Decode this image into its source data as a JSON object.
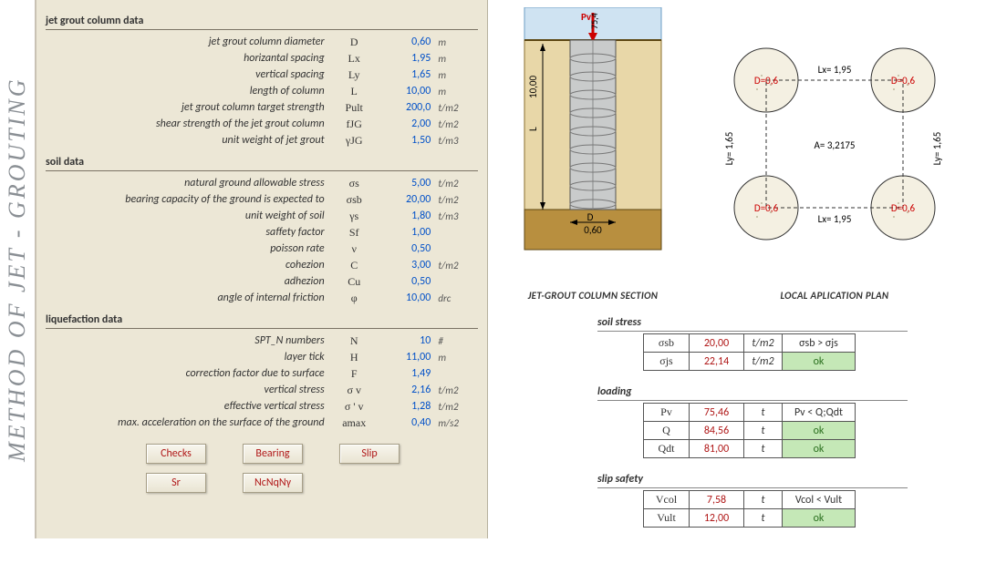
{
  "sideTitle": "METHOD OF JET - GROUTING",
  "sections": {
    "jg": {
      "title": "jet grout column data",
      "rows": [
        {
          "lbl": "jet grout column diameter",
          "sym": "D",
          "val": "0,60",
          "unit": "m"
        },
        {
          "lbl": "horizantal spacing",
          "sym": "Lx",
          "val": "1,95",
          "unit": "m"
        },
        {
          "lbl": "vertical spacing",
          "sym": "Ly",
          "val": "1,65",
          "unit": "m"
        },
        {
          "lbl": "length of column",
          "sym": "L",
          "val": "10,00",
          "unit": "m"
        },
        {
          "lbl": "jet grout column target strength",
          "sym": "Pult",
          "val": "200,0",
          "unit": "t/m2"
        },
        {
          "lbl": "shear strength of the jet grout column",
          "sym": "fJG",
          "val": "2,00",
          "unit": "t/m2"
        },
        {
          "lbl": "unit weight of jet grout",
          "sym": "γJG",
          "val": "1,50",
          "unit": "t/m3"
        }
      ]
    },
    "soil": {
      "title": "soil data",
      "rows": [
        {
          "lbl": "natural ground allowable stress",
          "sym": "σs",
          "val": "5,00",
          "unit": "t/m2"
        },
        {
          "lbl": "bearing capacity of the ground is expected to",
          "sym": "σsb",
          "val": "20,00",
          "unit": "t/m2"
        },
        {
          "lbl": "unit weight of soil",
          "sym": "γs",
          "val": "1,80",
          "unit": "t/m3"
        },
        {
          "lbl": "saffety factor",
          "sym": "Sf",
          "val": "1,00",
          "unit": ""
        },
        {
          "lbl": "poisson rate",
          "sym": "ν",
          "val": "0,50",
          "unit": ""
        },
        {
          "lbl": "cohezion",
          "sym": "C",
          "val": "3,00",
          "unit": "t/m2"
        },
        {
          "lbl": "adhezion",
          "sym": "Cu",
          "val": "0,50",
          "unit": ""
        },
        {
          "lbl": "angle of internal friction",
          "sym": "φ",
          "val": "10,00",
          "unit": "drc"
        }
      ]
    },
    "liq": {
      "title": "liquefaction data",
      "rows": [
        {
          "lbl": "SPT_N numbers",
          "sym": "N",
          "val": "10",
          "unit": "#"
        },
        {
          "lbl": "layer tick",
          "sym": "H",
          "val": "11,00",
          "unit": "m"
        },
        {
          "lbl": "correction factor due to surface",
          "sym": "F",
          "val": "1,49",
          "unit": ""
        },
        {
          "lbl": "vertical stress",
          "sym": "σ v",
          "val": "2,16",
          "unit": "t/m2"
        },
        {
          "lbl": "effective vertical stress",
          "sym": "σ ' v",
          "val": "1,28",
          "unit": "t/m2"
        },
        {
          "lbl": "max. acceleration on the surface of the ground",
          "sym": "amax",
          "val": "0,40",
          "unit": "m/s2"
        }
      ]
    }
  },
  "buttons": {
    "checks": "Checks",
    "bearing": "Bearing",
    "slip": "Slip",
    "sr": "Sr",
    "ncnqny": "NcNqNγ"
  },
  "figSection": {
    "pvLabel": "Pv",
    "pvVal": "75,4",
    "L": "10,00",
    "Dlabel": "D",
    "Dval": "0,60",
    "caption": "JET-GROUT COLUMN SECTION"
  },
  "figPlan": {
    "D": "D=0,6",
    "Lx": "Lx= 1,95",
    "Ly": "Ly= 1,65",
    "A": "A= 3,2175",
    "caption": "LOCAL APLICATION PLAN"
  },
  "checks": {
    "soil": {
      "title": "soil stress",
      "rows": [
        {
          "sym": "σsb",
          "val": "20,00",
          "unit": "t/m2",
          "cond": "σsb > σjs"
        },
        {
          "sym": "σjs",
          "val": "22,14",
          "unit": "t/m2",
          "cond": "ok",
          "ok": true
        }
      ]
    },
    "loading": {
      "title": "loading",
      "rows": [
        {
          "sym": "Pv",
          "val": "75,46",
          "unit": "t",
          "cond": "Pv < Q;Qdt"
        },
        {
          "sym": "Q",
          "val": "84,56",
          "unit": "t",
          "cond": "ok",
          "ok": true
        },
        {
          "sym": "Qdt",
          "val": "81,00",
          "unit": "t",
          "cond": "ok",
          "ok": true
        }
      ]
    },
    "slip": {
      "title": "slip safety",
      "rows": [
        {
          "sym": "Vcol",
          "val": "7,58",
          "unit": "t",
          "cond": "Vcol < Vult"
        },
        {
          "sym": "Vult",
          "val": "12,00",
          "unit": "t",
          "cond": "ok",
          "ok": true
        }
      ]
    }
  }
}
